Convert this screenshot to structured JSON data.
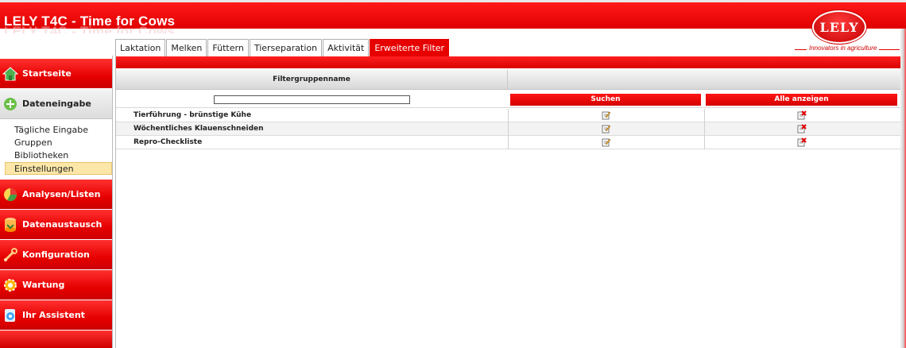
{
  "header": {
    "title": "LELY T4C - Time for Cows",
    "logo_text": "LELY",
    "tagline": "Innovators in agriculture"
  },
  "colors": {
    "brand_red": "#e60000",
    "active_sub_item": "#fde7a8"
  },
  "tabs": [
    {
      "label": "Laktation",
      "active": false
    },
    {
      "label": "Melken",
      "active": false
    },
    {
      "label": "Füttern",
      "active": false
    },
    {
      "label": "Tierseparation",
      "active": false
    },
    {
      "label": "Aktivität",
      "active": false
    },
    {
      "label": "Erweiterte Filter",
      "active": true
    }
  ],
  "sidebar": {
    "top_items": [
      {
        "label": "Startseite",
        "icon": "house-icon"
      },
      {
        "label": "Dateneingabe",
        "icon": "plus-icon"
      }
    ],
    "sub_items": [
      {
        "label": "Tägliche Eingabe",
        "active": false
      },
      {
        "label": "Gruppen",
        "active": false
      },
      {
        "label": "Bibliotheken",
        "active": false
      },
      {
        "label": "Einstellungen",
        "active": true
      }
    ],
    "bottom_items": [
      {
        "label": "Analysen/Listen",
        "icon": "pie-chart-icon"
      },
      {
        "label": "Datenaustausch",
        "icon": "database-icon"
      },
      {
        "label": "Konfiguration",
        "icon": "wrench-icon"
      },
      {
        "label": "Wartung",
        "icon": "gear-icon"
      },
      {
        "label": "Ihr Assistent",
        "icon": "assistant-icon"
      }
    ]
  },
  "main": {
    "column_header": "Filtergruppenname",
    "search_value": "",
    "search_button": "Suchen",
    "show_all_button": "Alle anzeigen",
    "rows": [
      {
        "name": "Tierführung - brünstige Kühe",
        "edit_icon": "edit-icon",
        "delete_icon": "delete-icon"
      },
      {
        "name": "Wöchentliches Klauenschneiden",
        "edit_icon": "edit-icon",
        "delete_icon": "delete-icon"
      },
      {
        "name": "Repro-Checkliste",
        "edit_icon": "edit-icon",
        "delete_icon": "delete-icon"
      }
    ]
  }
}
